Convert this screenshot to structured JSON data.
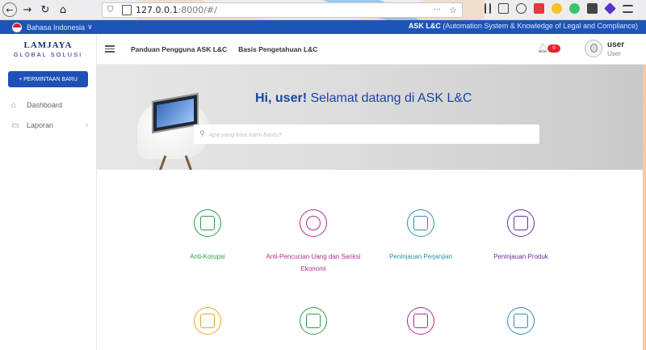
{
  "browser": {
    "url_host": "127.0.0.1",
    "url_path": ":8000/#/"
  },
  "app_header": {
    "language": "Bahasa Indonesia",
    "language_caret": "∨",
    "app_name": "ASK L&C",
    "app_tagline": " (Automation System & Knowledge of Legal and Compliance)"
  },
  "sidebar": {
    "logo_line1": "LAMJAYA",
    "logo_line2": "GLOBAL SOLUSI",
    "new_request_button": "+ PERMINTAAN BARU",
    "items": [
      {
        "label": "Dashboard",
        "icon": "home-icon"
      },
      {
        "label": "Laporan",
        "icon": "report-icon",
        "has_chevron": true
      }
    ]
  },
  "navbar": {
    "links": [
      "Panduan Pengguna ASK L&C",
      "Basis Pengetahuan L&C"
    ],
    "notification_count": "0",
    "user_name": "user",
    "user_role": "User"
  },
  "hero": {
    "greeting_bold": "Hi, user!",
    "greeting_rest": " Selamat datang di ASK L&C",
    "search_placeholder": "Apa yang bisa kami bantu?"
  },
  "tiles": [
    {
      "label": "Anti-Korupsi",
      "color": "#2e9c49"
    },
    {
      "label": "Anti-Pencucian Uang dan Sanksi Ekonomi",
      "color": "#b02d8c"
    },
    {
      "label": "Peninjauan Perjanjian",
      "color": "#2f8fae"
    },
    {
      "label": "Peninjauan Produk",
      "color": "#6e2ea0"
    },
    {
      "label": "",
      "color": "#e7a62a"
    },
    {
      "label": "",
      "color": "#2e9c49"
    },
    {
      "label": "",
      "color": "#b02d8c"
    },
    {
      "label": "",
      "color": "#2f8fae"
    }
  ]
}
